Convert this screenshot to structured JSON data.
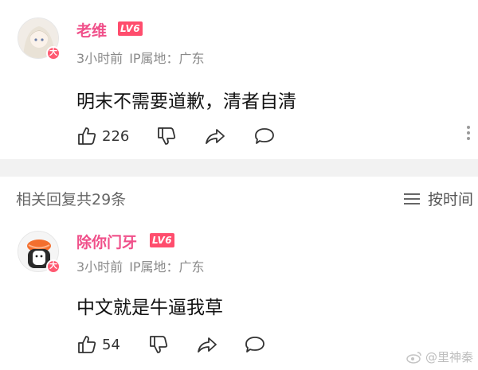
{
  "comment_main": {
    "username": "老维",
    "level": "LV6",
    "time": "3小时前",
    "ip": "IP属地：广东",
    "content": "明末不需要道歉，清者自清",
    "likes": "226",
    "avatar_badge": "大"
  },
  "replies_header": {
    "title": "相关回复共29条",
    "sort_label": "按时间"
  },
  "comment_reply": {
    "username": "除你门牙",
    "level": "LV6",
    "time": "3小时前",
    "ip": "IP属地：广东",
    "content": "中文就是牛逼我草",
    "likes": "54",
    "avatar_badge": "大"
  },
  "watermark": "@里神秦",
  "icons": [
    "like-icon",
    "dislike-icon",
    "share-icon",
    "comment-icon",
    "more-icon",
    "sort-icon",
    "weibo-icon"
  ],
  "colors": {
    "username": "#f0508a",
    "level_badge": "#ff4d6d",
    "meta": "#8a8a8a",
    "divider": "#f2f2f2"
  }
}
